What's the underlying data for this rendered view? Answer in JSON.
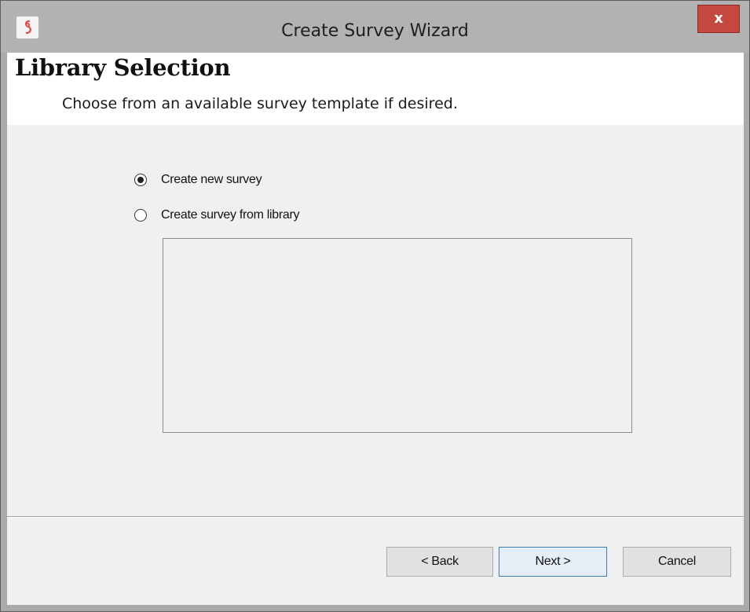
{
  "window": {
    "title": "Create Survey Wizard",
    "close_glyph": "x",
    "app_icon": "survey-app-icon"
  },
  "header": {
    "title": "Library Selection",
    "subtitle": "Choose from an available survey template if desired."
  },
  "options": {
    "new_survey_label": "Create new survey",
    "new_survey_selected": true,
    "from_library_label": "Create survey from library",
    "from_library_selected": false
  },
  "buttons": {
    "back": "< Back",
    "next": "Next >",
    "cancel": "Cancel"
  },
  "colors": {
    "close_button": "#c4483f",
    "default_button_border": "#3c7fb1",
    "dialog_background": "#f0f0f0",
    "titlebar": "#b2b2b2"
  }
}
